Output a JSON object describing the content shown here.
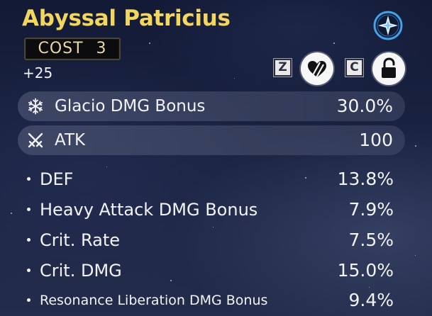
{
  "echo": {
    "name": "Abyssal Patricius",
    "cost_label": "COST",
    "cost_value": "3",
    "level": "+25",
    "set_icon": "sonata-compass-star-icon"
  },
  "controls": {
    "favorite_key": "Z",
    "favorite_icon": "heart-icon",
    "lock_key": "C",
    "lock_icon": "unlocked-padlock-icon"
  },
  "main_stats": [
    {
      "icon": "snowflake-icon",
      "label": "Glacio DMG Bonus",
      "value": "30.0%"
    },
    {
      "icon": "crossed-swords-icon",
      "label": "ATK",
      "value": "100"
    }
  ],
  "sub_stats": [
    {
      "label": "DEF",
      "value": "13.8%"
    },
    {
      "label": "Heavy Attack DMG Bonus",
      "value": "7.9%"
    },
    {
      "label": "Crit. Rate",
      "value": "7.5%"
    },
    {
      "label": "Crit. DMG",
      "value": "15.0%"
    },
    {
      "label": "Resonance Liberation DMG Bonus",
      "value": "9.4%"
    }
  ],
  "colors": {
    "title": "#f3d65d",
    "text": "#f2f3f5",
    "background": "#1a2341",
    "row_highlight": "#56607d",
    "sonata_ring": "#3fa4ea"
  }
}
